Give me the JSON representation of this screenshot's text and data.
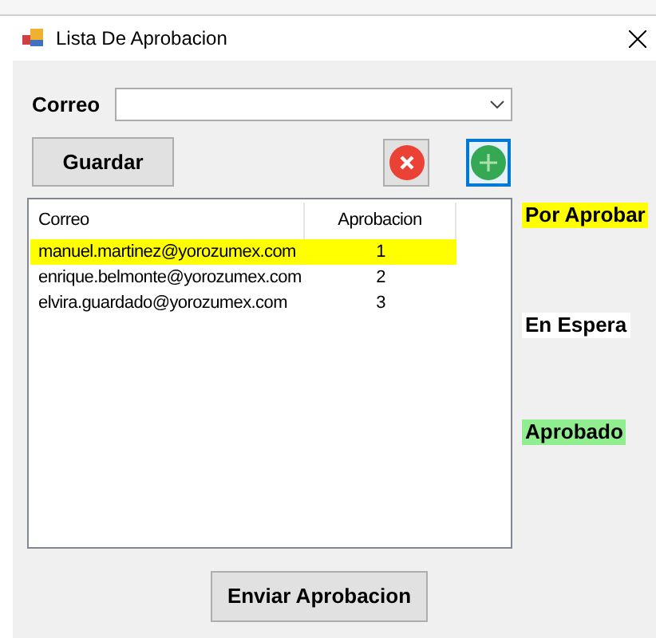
{
  "window": {
    "title": "Lista De Aprobacion"
  },
  "correo": {
    "label": "Correo"
  },
  "buttons": {
    "save": "Guardar",
    "send": "Enviar Aprobacion"
  },
  "table": {
    "columns": [
      "Correo",
      "Aprobacion"
    ],
    "rows": [
      {
        "email": "manuel.martinez@yorozumex.com",
        "order": "1",
        "selected": true
      },
      {
        "email": "enrique.belmonte@yorozumex.com",
        "order": "2",
        "selected": false
      },
      {
        "email": "elvira.guardado@yorozumex.com",
        "order": "3",
        "selected": false
      }
    ]
  },
  "legend": [
    {
      "label": "Por Aprobar",
      "color": "#ffff00"
    },
    {
      "label": "En Espera",
      "color": "#ffffff"
    },
    {
      "label": "Aprobado",
      "color": "#90ee90"
    }
  ]
}
